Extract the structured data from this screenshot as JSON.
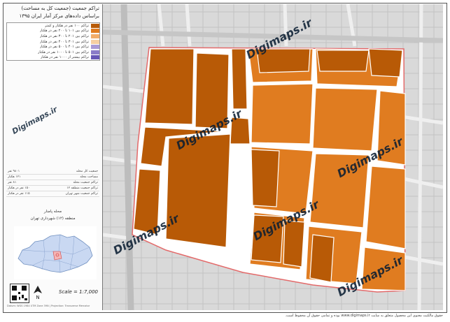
{
  "panel": {
    "title_line1": "تراکم جمعیت (جمعیت کل به مساحت)",
    "title_line2": "براساس داده‌های مرکز آمار ایران ۱۳۹۵",
    "legend": [
      {
        "label": "تراکم ۱۰۰ نفر در هکتار و کمتر",
        "color": "#b85a06"
      },
      {
        "label": "تراکم بین ۱۰۱ تا ۲۰۰ نفر در هکتار",
        "color": "#e07c20"
      },
      {
        "label": "تراکم بین ۲۰۱ تا ۳۰۰ نفر در هکتار",
        "color": "#f2ad6a"
      },
      {
        "label": "تراکم بین ۳۰۱ تا ۴۰۰ نفر در هکتار",
        "color": "#f6cfa2"
      },
      {
        "label": "تراکم بین ۴۰۱ تا ۵۰۰ نفر در هکتار",
        "color": "#a99ad6"
      },
      {
        "label": "تراکم بین ۵۰۱ تا ۱۰۰۰ نفر در هکتار",
        "color": "#8a7cc8"
      },
      {
        "label": "تراکم بیشتر از ۱۰۰۰ نفر در هکتار",
        "color": "#6656b6"
      }
    ],
    "stats": [
      {
        "label": "جمعیت کل محله",
        "value": "۹۸۰۱ نفر"
      },
      {
        "label": "مساحت محله",
        "value": "۱۲۱ هکتار"
      },
      {
        "label": "تراکم جمعیت محله",
        "value": "۸۱ نفر"
      },
      {
        "label": "تراکم جمعیت منطقه ۱۲",
        "value": "۱۵۰ نفر در هکتار"
      },
      {
        "label": "تراکم جمعیت شهر تهران",
        "value": "۱۱۵ نفر در هکتار"
      }
    ],
    "region_title": "محله پامنار",
    "region_subtitle": "منطقه (۱۲) شهرداری تهران",
    "scale": "Scale = 1:7,000",
    "footer_small": "Datum: WGS 1984 UTM Zone 39N | Projection: Transverse Mercator"
  },
  "watermark": "Digimaps.ir",
  "footer": "حقوق مالکیت معنوی این محصول متعلق به سایت www.digimaps.ir بوده و تمامی حقوق آن محفوظ است.",
  "colors": {
    "low": "#b85a06",
    "mid": "#e07c20",
    "boundary": "#e36a6a"
  }
}
